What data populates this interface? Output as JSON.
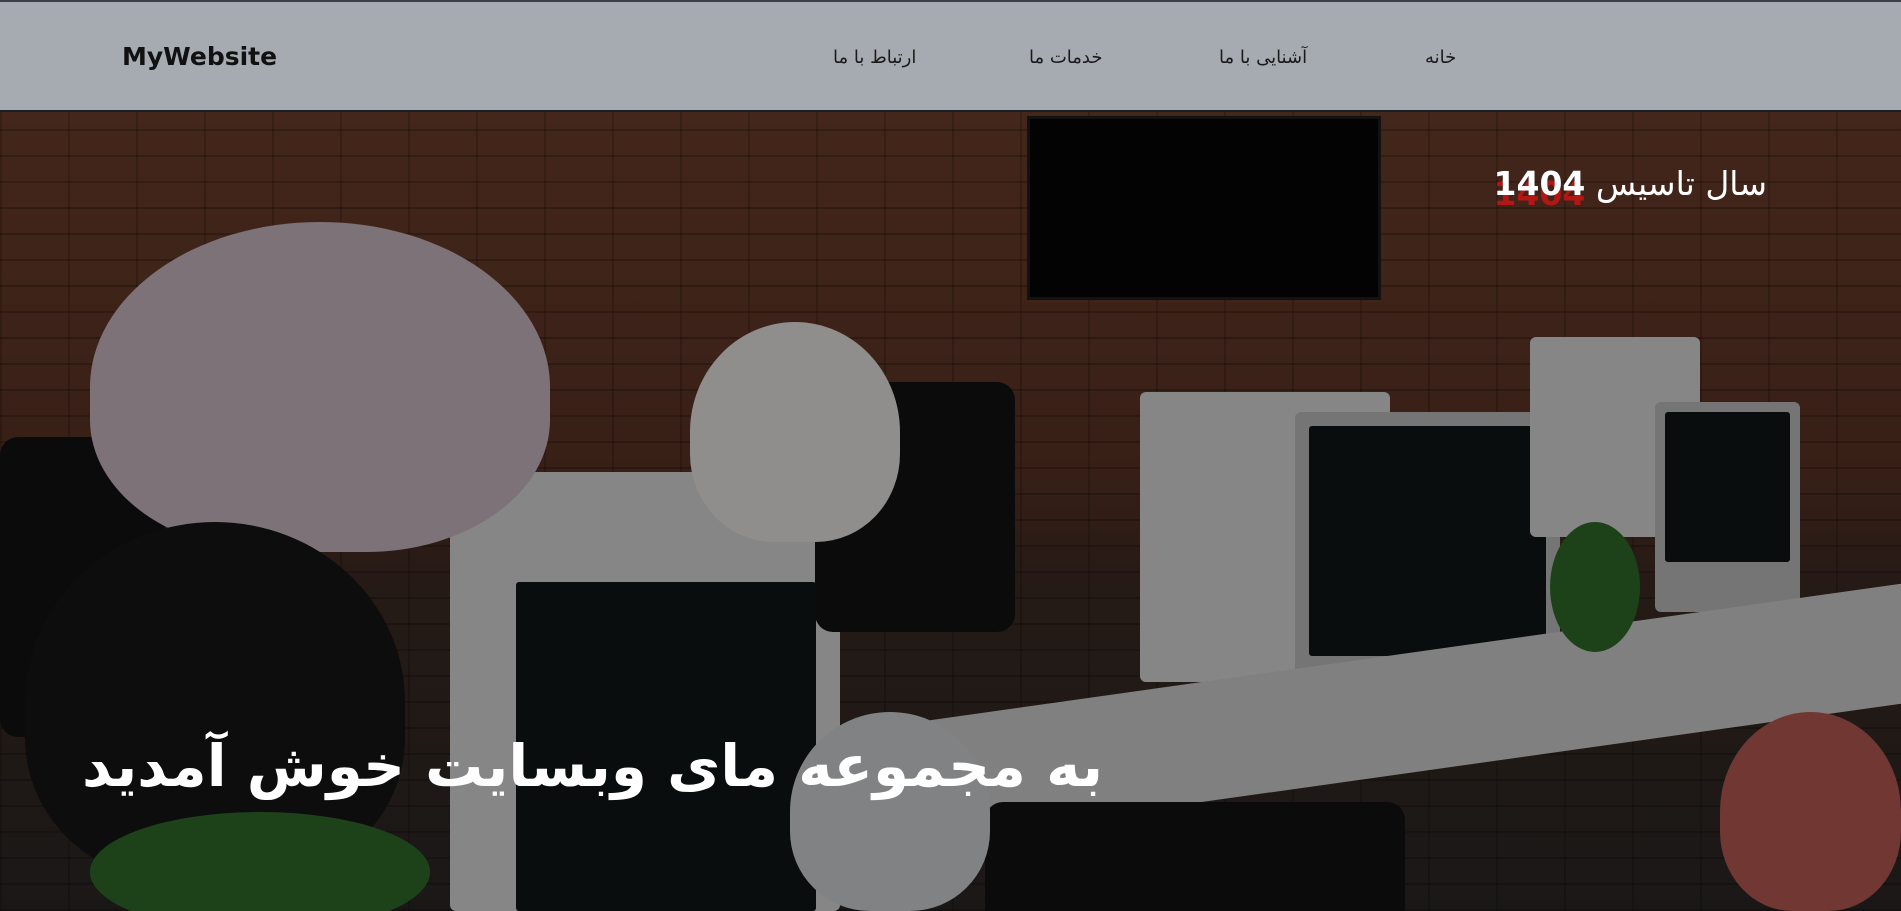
{
  "navbar": {
    "brand": "MyWebsite",
    "links": [
      {
        "label": "خانه"
      },
      {
        "label": "آشنایی با ما"
      },
      {
        "label": "خدمات ما"
      },
      {
        "label": "ارتباط با ما"
      }
    ]
  },
  "hero": {
    "since_label": "سال تاسیس",
    "since_year": "1404",
    "welcome": "به مجموعه مای وبسایت خوش آمدید"
  },
  "colors": {
    "navbar_bg": "#a6abb2",
    "hero_text": "#ffffff",
    "year_shadow": "#c81414"
  }
}
